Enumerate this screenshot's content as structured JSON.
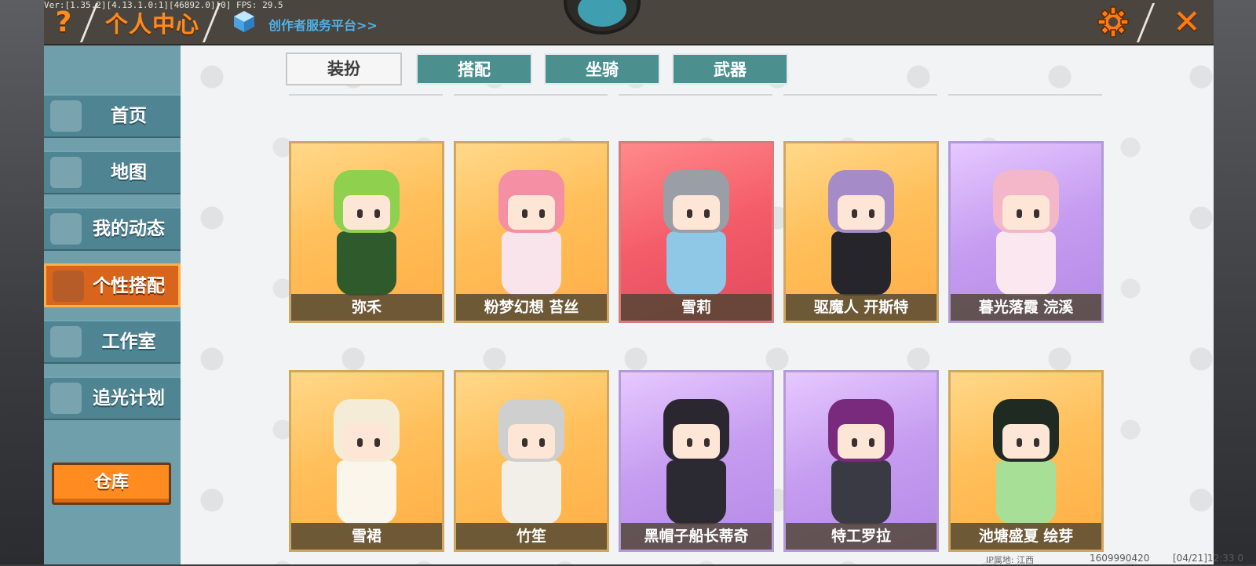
{
  "debug_text": "Ver:[1.35.2][4.13.1.0:1][46892.0][0] FPS: 29.5",
  "header": {
    "title": "个人中心",
    "creator_link": "创作者服务平台>>",
    "help_icon": "question-icon",
    "settings_icon": "gear-icon",
    "close_icon": "close-icon"
  },
  "sidebar": {
    "items": [
      {
        "label": "首页",
        "icon": "home-icon",
        "active": false
      },
      {
        "label": "地图",
        "icon": "map-icon",
        "active": false
      },
      {
        "label": "我的动态",
        "icon": "bell-icon",
        "active": false
      },
      {
        "label": "个性搭配",
        "icon": "outfit-icon",
        "active": true
      },
      {
        "label": "工作室",
        "icon": "studio-icon",
        "active": false
      },
      {
        "label": "追光计划",
        "icon": "light-icon",
        "active": false
      }
    ],
    "warehouse_label": "仓库"
  },
  "tabs": [
    {
      "label": "装扮",
      "active": true
    },
    {
      "label": "搭配",
      "active": false
    },
    {
      "label": "坐骑",
      "active": false
    },
    {
      "label": "武器",
      "active": false
    }
  ],
  "cards": [
    {
      "name": "弥禾",
      "theme": "orange",
      "hair": "#8fd14f",
      "outfit": "#2f5a2c"
    },
    {
      "name": "粉梦幻想 苔丝",
      "theme": "orange",
      "hair": "#f58fa3",
      "outfit": "#f8e4ea"
    },
    {
      "name": "雪莉",
      "theme": "red",
      "hair": "#9a9ea6",
      "outfit": "#8fc8e6"
    },
    {
      "name": "驱魔人 开斯特",
      "theme": "orange",
      "hair": "#a58bc7",
      "outfit": "#26252c"
    },
    {
      "name": "暮光落霞 浣溪",
      "theme": "purple",
      "hair": "#f3b7c9",
      "outfit": "#fbe7f0"
    },
    {
      "name": "雪裙",
      "theme": "orange",
      "hair": "#f4ecd6",
      "outfit": "#faf6ec"
    },
    {
      "name": "竹笙",
      "theme": "orange",
      "hair": "#cfcfcf",
      "outfit": "#f2efe9"
    },
    {
      "name": "黑帽子船长蒂奇",
      "theme": "purple",
      "hair": "#2a2730",
      "outfit": "#2b2a33"
    },
    {
      "name": "特工罗拉",
      "theme": "purple",
      "hair": "#7a2a7c",
      "outfit": "#3a3a44"
    },
    {
      "name": "池塘盛夏 绘芽",
      "theme": "orange",
      "hair": "#1f2a22",
      "outfit": "#a8df96"
    }
  ],
  "footer": {
    "ip_location": "IP属地: 江西",
    "user_id": "1609990420",
    "timestamp": "[04/21]12:33 0"
  }
}
